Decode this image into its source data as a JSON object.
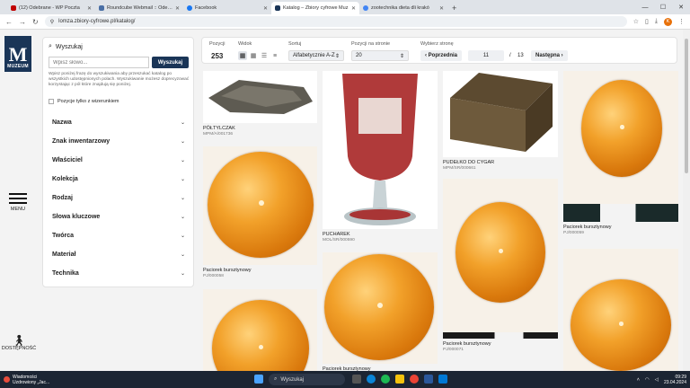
{
  "browser": {
    "tabs": [
      {
        "label": "(12) Odebrane - WP Poczta",
        "color": "#c00000",
        "active": false
      },
      {
        "label": "Roundcube Webmail :: Odebra",
        "color": "#4a6fa5",
        "active": false
      },
      {
        "label": "Facebook",
        "color": "#1877f2",
        "active": false
      },
      {
        "label": "Katalog – Zbiory cyfrowe Muz",
        "color": "#1a3557",
        "active": true
      },
      {
        "label": "zootechnika dieta dli krakó",
        "color": "#4285f4",
        "active": false
      }
    ],
    "new_tab": "+",
    "url": "lomza.zbiory-cyfrowe.pl/katalog/",
    "profile_initial": "K"
  },
  "site": {
    "logo_text": "MUZEUM",
    "menu_label": "MENU",
    "accessibility_label": "DOSTĘPNOŚĆ"
  },
  "search": {
    "heading": "Wyszukaj",
    "placeholder": "Wpisz słowo...",
    "button": "Wyszukaj",
    "help": "Wpisz poniżej frazę do wyszukiwania aby przeszukać katalog po wszystkich udostępnionych polach. Wyszukiwanie możesz doprecyzować korzystając z pól które znajdują się poniżej.",
    "images_only": "Pozycje tylko z wizerunkiem"
  },
  "facets": [
    "Nazwa",
    "Znak inwentarzowy",
    "Właściciel",
    "Kolekcja",
    "Rodzaj",
    "Słowa kluczowe",
    "Twórca",
    "Materiał",
    "Technika"
  ],
  "toolbar": {
    "count_label": "Pozycji",
    "count": "253",
    "view_label": "Widok",
    "sort_label": "Sortuj",
    "sort_value": "Alfabetycznie A-Z",
    "per_page_label": "Pozycji na stronie",
    "per_page_value": "20",
    "page_label": "Wybierz stronę",
    "prev": "Poprzednia",
    "page": "11",
    "of": "/",
    "total_pages": "13",
    "next": "Następna"
  },
  "items": [
    {
      "title": "PÓŁTYLCZAK",
      "id": "MPM/A/001736"
    },
    {
      "title": "Paciorek bursztynowy",
      "id": "PJ/000058"
    },
    {
      "title": "PUCHAREK",
      "id": "MOL/SR/000590"
    },
    {
      "title": "Paciorek bursztynowy",
      "id": ""
    },
    {
      "title": "PUDEŁKO DO CYGAR",
      "id": "MPM/SR/000661"
    },
    {
      "title": "Paciorek bursztynowy",
      "id": "PJ/000071"
    },
    {
      "title": "Paciorek bursztynowy",
      "id": "PJ/000059"
    }
  ],
  "taskbar": {
    "weather_title": "Wiadomości",
    "weather_sub": "Uzdrowiony „Jac...",
    "search": "Wyszukaj",
    "time": "09:29",
    "date": "23.04.2024"
  }
}
